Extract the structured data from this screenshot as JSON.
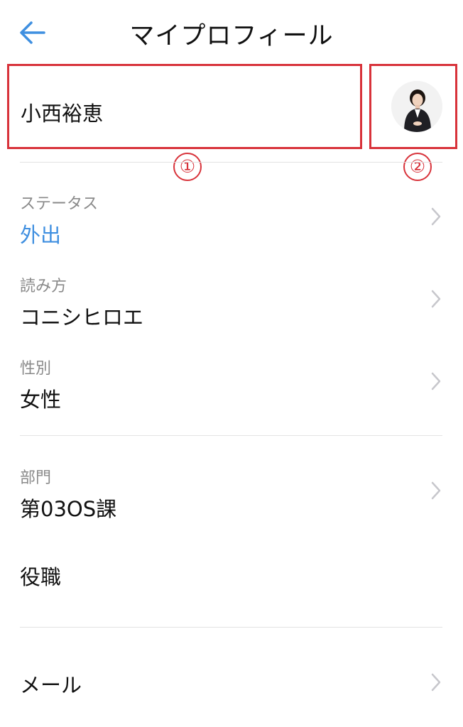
{
  "header": {
    "title": "マイプロフィール"
  },
  "profile": {
    "name": "小西裕恵",
    "marker_1": "①",
    "marker_2": "②"
  },
  "fields": {
    "status": {
      "label": "ステータス",
      "value": "外出"
    },
    "reading": {
      "label": "読み方",
      "value": "コニシヒロエ"
    },
    "gender": {
      "label": "性別",
      "value": "女性"
    },
    "department": {
      "label": "部門",
      "value": "第03OS課"
    },
    "position": {
      "label": "役職"
    },
    "email": {
      "label": "メール"
    }
  },
  "colors": {
    "accent": "#3f8fe0",
    "highlight_border": "#d8323a",
    "chevron": "#c7c7cc"
  }
}
